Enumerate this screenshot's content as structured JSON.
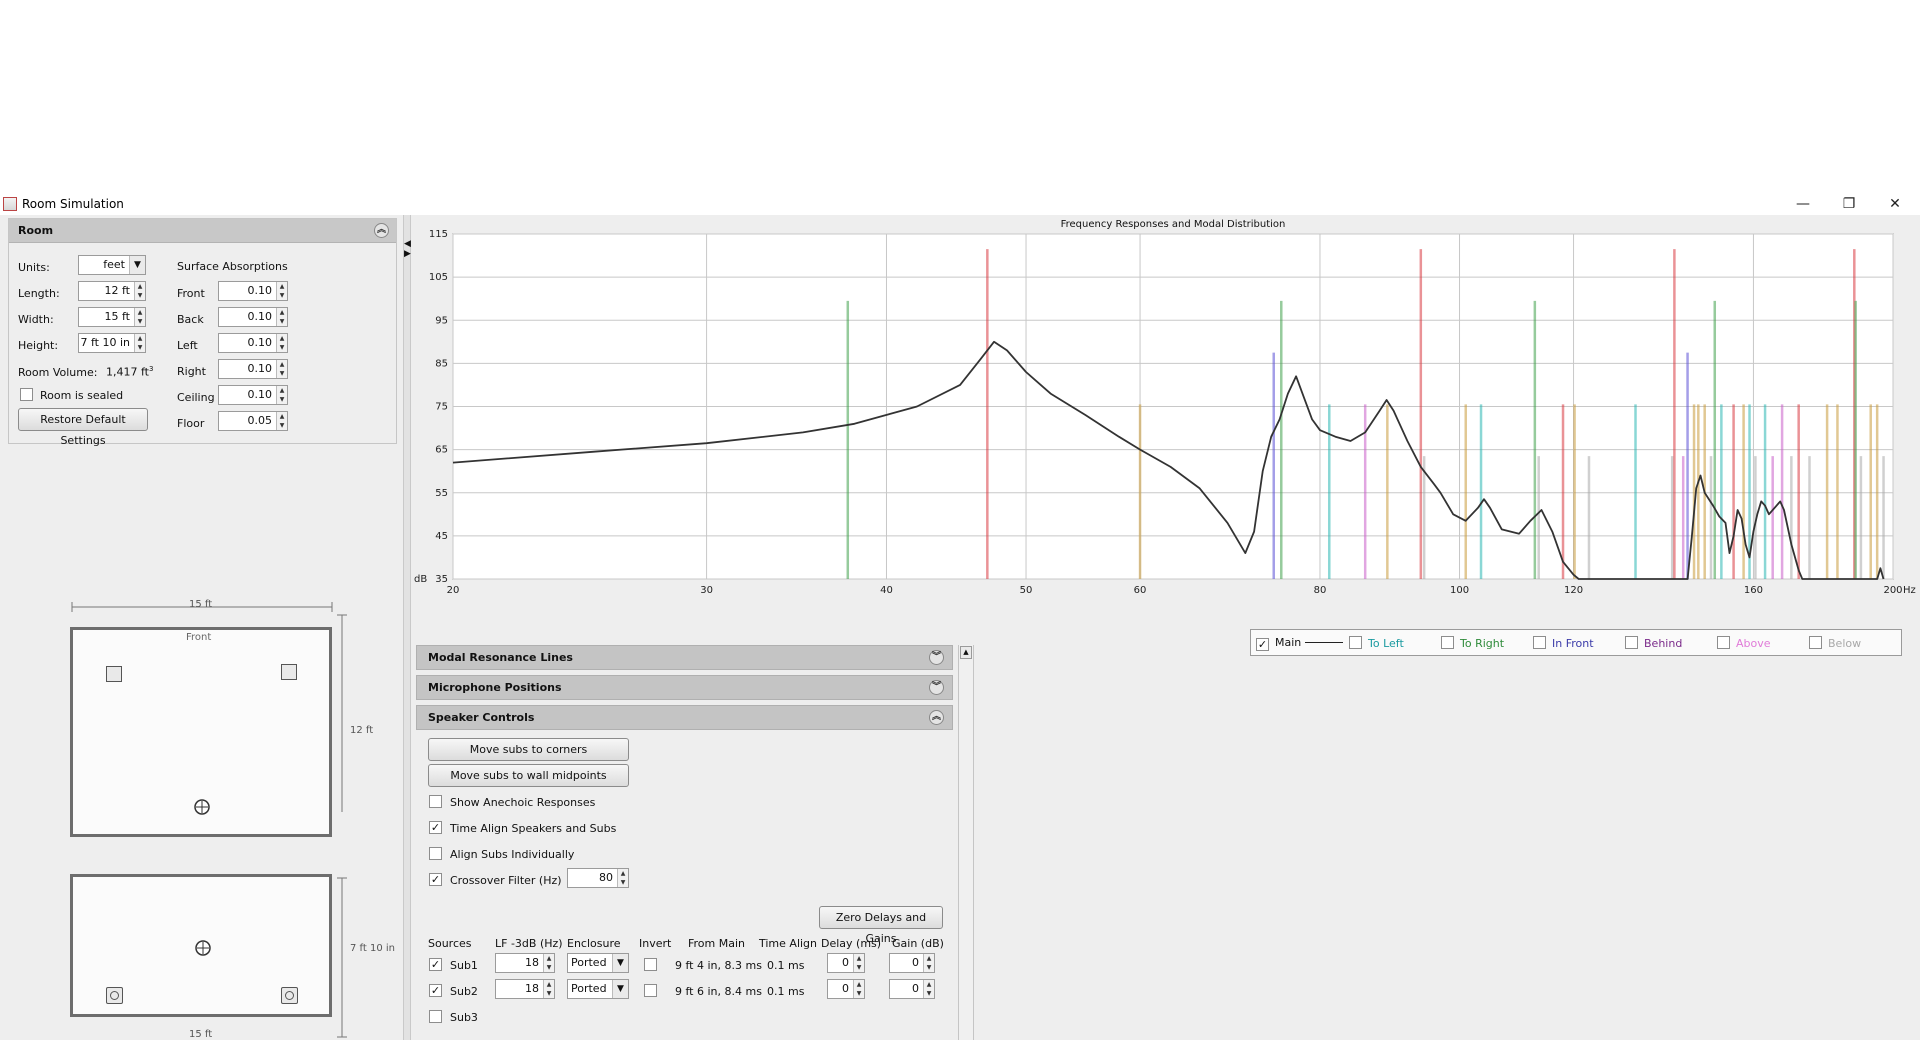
{
  "window": {
    "title": "Room Simulation",
    "minimize": "—",
    "restore": "❐",
    "close": "✕"
  },
  "room": {
    "header": "Room",
    "units_label": "Units:",
    "units_value": "feet",
    "length_label": "Length:",
    "length_value": "12 ft",
    "width_label": "Width:",
    "width_value": "15 ft",
    "height_label": "Height:",
    "height_value": "7 ft 10 in",
    "volume_label": "Room Volume:",
    "volume_value": "1,417 ft",
    "volume_unit_exp": "3",
    "sealed_label": "Room is sealed",
    "restore_button": "Restore Default Settings",
    "absorptions_title": "Surface Absorptions",
    "surfaces": [
      {
        "label": "Front",
        "value": "0.10"
      },
      {
        "label": "Back",
        "value": "0.10"
      },
      {
        "label": "Left",
        "value": "0.10"
      },
      {
        "label": "Right",
        "value": "0.10"
      },
      {
        "label": "Ceiling",
        "value": "0.10"
      },
      {
        "label": "Floor",
        "value": "0.05"
      }
    ]
  },
  "plan_top": {
    "width_label": "15 ft",
    "depth_label": "12 ft",
    "front_label": "Front"
  },
  "plan_side": {
    "height_label": "7 ft 10 in",
    "width_label": "15 ft"
  },
  "chart_data": {
    "type": "line",
    "title": "Frequency Responses and Modal Distribution",
    "xlabel": "Hz",
    "ylabel": "dB",
    "xlim": [
      20,
      200
    ],
    "ylim": [
      35,
      115
    ],
    "x_ticks": [
      20,
      30,
      40,
      50,
      60,
      80,
      100,
      120,
      160,
      200
    ],
    "y_ticks": [
      35,
      45,
      55,
      65,
      75,
      85,
      95,
      105,
      115
    ],
    "grid": true,
    "series": [
      {
        "name": "Main",
        "color": "#333333",
        "points": [
          [
            20,
            62
          ],
          [
            25,
            64.5
          ],
          [
            30,
            66.5
          ],
          [
            35,
            69
          ],
          [
            38,
            71
          ],
          [
            42,
            75
          ],
          [
            45,
            80
          ],
          [
            46.5,
            86
          ],
          [
            47.5,
            90
          ],
          [
            48.5,
            88
          ],
          [
            50,
            83
          ],
          [
            52,
            78
          ],
          [
            55,
            73
          ],
          [
            58,
            68
          ],
          [
            60,
            65
          ],
          [
            63,
            61
          ],
          [
            66,
            56
          ],
          [
            69,
            48
          ],
          [
            71,
            41
          ],
          [
            72,
            46
          ],
          [
            73,
            60
          ],
          [
            74,
            68
          ],
          [
            75,
            72
          ],
          [
            76,
            78
          ],
          [
            77,
            82
          ],
          [
            78,
            77
          ],
          [
            79,
            72
          ],
          [
            80,
            69.5
          ],
          [
            82,
            68
          ],
          [
            84,
            67
          ],
          [
            86,
            69
          ],
          [
            88,
            74
          ],
          [
            89,
            76.5
          ],
          [
            90,
            74
          ],
          [
            92,
            67
          ],
          [
            94,
            61
          ],
          [
            96,
            57
          ],
          [
            97,
            55
          ],
          [
            99,
            50
          ],
          [
            101,
            48.5
          ],
          [
            103,
            51.5
          ],
          [
            104,
            53.5
          ],
          [
            105,
            51.5
          ],
          [
            107,
            46.5
          ],
          [
            110,
            45.5
          ],
          [
            112,
            48.5
          ],
          [
            114,
            51
          ],
          [
            116,
            46
          ],
          [
            118,
            39
          ],
          [
            120,
            36
          ],
          [
            121,
            35
          ],
          [
            144,
            35
          ],
          [
            145,
            45
          ],
          [
            146,
            56
          ],
          [
            147,
            59
          ],
          [
            148,
            55
          ],
          [
            150,
            52
          ],
          [
            151.5,
            49.5
          ],
          [
            153,
            48
          ],
          [
            154,
            41
          ],
          [
            155,
            45
          ],
          [
            156,
            51
          ],
          [
            157,
            49
          ],
          [
            158,
            43
          ],
          [
            159,
            40
          ],
          [
            160,
            46
          ],
          [
            161,
            50
          ],
          [
            162,
            53
          ],
          [
            163,
            52
          ],
          [
            164,
            50
          ],
          [
            166,
            52
          ],
          [
            167,
            53
          ],
          [
            168,
            51
          ],
          [
            170,
            43
          ],
          [
            172,
            37
          ],
          [
            173,
            35
          ],
          [
            195,
            35
          ],
          [
            196,
            37.5
          ],
          [
            197,
            35
          ]
        ]
      }
    ],
    "modes": [
      {
        "f": 37.6,
        "top": 99.5,
        "color": "#3fa14a"
      },
      {
        "f": 47.0,
        "top": 111.5,
        "color": "#d9383f"
      },
      {
        "f": 60.0,
        "top": 75.5,
        "color": "#c99a3a"
      },
      {
        "f": 74.3,
        "top": 87.5,
        "color": "#5a4fd6"
      },
      {
        "f": 75.2,
        "top": 99.5,
        "color": "#3fa14a"
      },
      {
        "f": 81.2,
        "top": 75.5,
        "color": "#2ab6b3"
      },
      {
        "f": 86.0,
        "top": 75.5,
        "color": "#c85cc9"
      },
      {
        "f": 89.1,
        "top": 75.5,
        "color": "#c99a3a"
      },
      {
        "f": 94.0,
        "top": 111.5,
        "color": "#d9383f"
      },
      {
        "f": 94.5,
        "top": 63.5,
        "color": "#a9a9a9"
      },
      {
        "f": 101.0,
        "top": 75.5,
        "color": "#c99a3a"
      },
      {
        "f": 103.5,
        "top": 75.5,
        "color": "#2ab6b3"
      },
      {
        "f": 112.8,
        "top": 99.5,
        "color": "#3fa14a"
      },
      {
        "f": 113.5,
        "top": 63.5,
        "color": "#a9a9a9"
      },
      {
        "f": 118.0,
        "top": 75.5,
        "color": "#d9383f"
      },
      {
        "f": 120.2,
        "top": 75.5,
        "color": "#c99a3a"
      },
      {
        "f": 123.0,
        "top": 63.5,
        "color": "#a9a9a9"
      },
      {
        "f": 132.5,
        "top": 75.5,
        "color": "#2ab6b3"
      },
      {
        "f": 140.5,
        "top": 63.5,
        "color": "#a9a9a9"
      },
      {
        "f": 141.0,
        "top": 111.5,
        "color": "#d9383f"
      },
      {
        "f": 143.0,
        "top": 63.5,
        "color": "#c85cc9"
      },
      {
        "f": 144.0,
        "top": 87.5,
        "color": "#5a4fd6"
      },
      {
        "f": 145.5,
        "top": 75.5,
        "color": "#c99a3a"
      },
      {
        "f": 146.5,
        "top": 75.5,
        "color": "#c99a3a"
      },
      {
        "f": 148.0,
        "top": 75.5,
        "color": "#c99a3a"
      },
      {
        "f": 149.5,
        "top": 63.5,
        "color": "#a9a9a9"
      },
      {
        "f": 150.4,
        "top": 99.5,
        "color": "#3fa14a"
      },
      {
        "f": 152.0,
        "top": 75.5,
        "color": "#2ab6b3"
      },
      {
        "f": 155.0,
        "top": 75.5,
        "color": "#d9383f"
      },
      {
        "f": 157.5,
        "top": 75.5,
        "color": "#c99a3a"
      },
      {
        "f": 159.0,
        "top": 75.5,
        "color": "#2ab6b3"
      },
      {
        "f": 160.5,
        "top": 63.5,
        "color": "#a9a9a9"
      },
      {
        "f": 163.0,
        "top": 75.5,
        "color": "#2ab6b3"
      },
      {
        "f": 165.0,
        "top": 63.5,
        "color": "#c85cc9"
      },
      {
        "f": 167.5,
        "top": 75.5,
        "color": "#c85cc9"
      },
      {
        "f": 170.0,
        "top": 63.5,
        "color": "#a9a9a9"
      },
      {
        "f": 172.0,
        "top": 75.5,
        "color": "#d9383f"
      },
      {
        "f": 175.0,
        "top": 63.5,
        "color": "#a9a9a9"
      },
      {
        "f": 180.0,
        "top": 75.5,
        "color": "#c99a3a"
      },
      {
        "f": 183.0,
        "top": 75.5,
        "color": "#c99a3a"
      },
      {
        "f": 188.0,
        "top": 111.5,
        "color": "#d9383f"
      },
      {
        "f": 188.4,
        "top": 99.5,
        "color": "#3fa14a"
      },
      {
        "f": 190.0,
        "top": 63.5,
        "color": "#a9a9a9"
      },
      {
        "f": 193.0,
        "top": 75.5,
        "color": "#c99a3a"
      },
      {
        "f": 195.0,
        "top": 75.5,
        "color": "#c99a3a"
      },
      {
        "f": 197.0,
        "top": 63.5,
        "color": "#a9a9a9"
      }
    ],
    "legend": [
      {
        "label": "Main",
        "color": "#222222",
        "checked": true
      },
      {
        "label": "To Left",
        "color": "#1a9aa0",
        "checked": false
      },
      {
        "label": "To Right",
        "color": "#2e8b3a",
        "checked": false
      },
      {
        "label": "In Front",
        "color": "#3a3aa8",
        "checked": false
      },
      {
        "label": "Behind",
        "color": "#7a2a8a",
        "checked": false
      },
      {
        "label": "Above",
        "color": "#e07ad8",
        "checked": false
      },
      {
        "label": "Below",
        "color": "#a8a8a8",
        "checked": false
      }
    ]
  },
  "accordion": {
    "modal_header": "Modal Resonance Lines",
    "mic_header": "Microphone Positions",
    "speaker_header": "Speaker Controls"
  },
  "speaker": {
    "corners_button": "Move subs to corners",
    "midpoints_button": "Move subs to wall midpoints",
    "anechoic_label": "Show Anechoic Responses",
    "timealign_label": "Time Align Speakers and Subs",
    "individual_label": "Align Subs Individually",
    "crossover_label": "Crossover Filter (Hz)",
    "crossover_value": "80",
    "zero_button": "Zero Delays and Gains",
    "columns": [
      "Sources",
      "LF -3dB (Hz)",
      "Enclosure",
      "Invert",
      "From Main",
      "Time Align",
      "Delay (ms)",
      "Gain (dB)"
    ],
    "rows": [
      {
        "name": "Sub1",
        "lf": "18",
        "enclosure": "Ported",
        "from_main": "9 ft 4 in, 8.3 ms",
        "time_align": "0.1 ms",
        "delay": "0",
        "gain": "0"
      },
      {
        "name": "Sub2",
        "lf": "18",
        "enclosure": "Ported",
        "from_main": "9 ft 6 in, 8.4 ms",
        "time_align": "0.1 ms",
        "delay": "0",
        "gain": "0"
      },
      {
        "name": "Sub3"
      }
    ]
  }
}
